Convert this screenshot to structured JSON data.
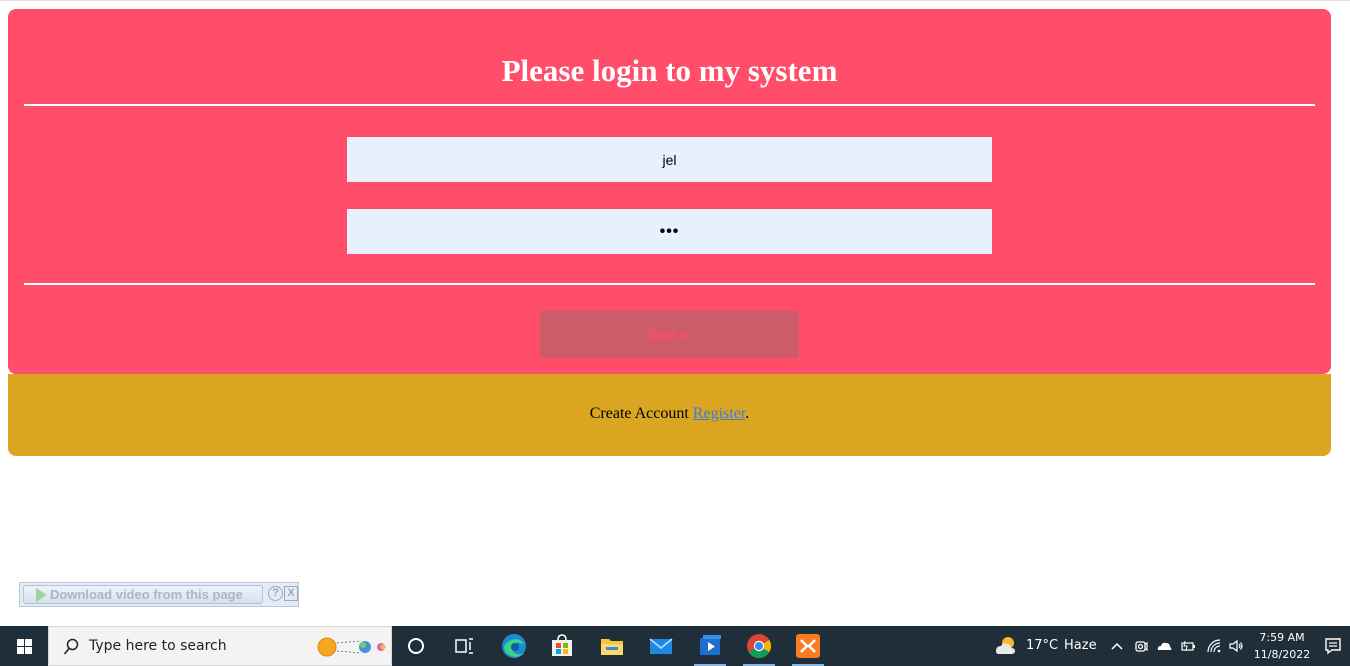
{
  "login": {
    "title": "Please login to my system",
    "username_value": "jel",
    "password_value": "•••",
    "signin_label": "Sign In"
  },
  "register": {
    "prefix": "Create Account ",
    "link_label": "Register",
    "suffix": "."
  },
  "download_bar": {
    "label": "Download video from this page",
    "help": "?",
    "close": "X"
  },
  "taskbar": {
    "search_placeholder": "Type here to search",
    "apps": [
      "cortana-icon",
      "task-view-icon",
      "edge-icon",
      "store-icon",
      "file-explorer-icon",
      "mail-icon",
      "media-player-icon",
      "chrome-icon",
      "xampp-icon"
    ],
    "weather_temp": "17°C",
    "weather_desc": "Haze",
    "time": "7:59 AM",
    "date": "11/8/2022"
  },
  "colors": {
    "login_bg": "#ff4d6a",
    "register_bg": "#daa520",
    "field_bg": "#e8f0fe",
    "signin_bg": "#cc5c69",
    "taskbar_bg": "#1f2e38"
  }
}
